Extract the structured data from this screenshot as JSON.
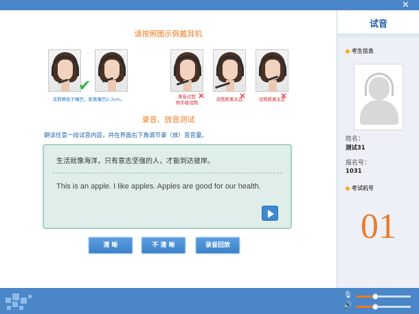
{
  "window": {
    "close_glyph": "✕"
  },
  "main": {
    "wear_title": "请按照图示佩戴耳机",
    "test_title": "录音、放音测试",
    "instruction": "朗读任意一段试音内容，并在界面右下角调节录（放）音音量。",
    "captions": {
      "good_line1": "话筒略低于嘴巴，距离嘴巴2-3cm。",
      "bad1_line1": "录音过程",
      "bad1_line2": "用手碰话筒",
      "bad2": "话筒距离太远",
      "bad3": "话筒距离太近"
    },
    "sample_text": {
      "chinese": "生活就像海洋，只有意志坚强的人，才能到达彼岸。",
      "english": "This is an apple. I like apples. Apples are good for our health."
    },
    "buttons": {
      "clear": "清  晰",
      "unclear": "不 清 晰",
      "playback": "录音回放"
    }
  },
  "sidebar": {
    "title": "试音",
    "candidate_info_label": "考生信息",
    "name_label": "姓名：",
    "name_value": "测试31",
    "exam_id_label": "报名号：",
    "exam_id_value": "1031",
    "machine_label": "考试机号",
    "machine_number": "01"
  },
  "volume": {
    "mic_level": 0.35,
    "speaker_level": 0.35
  },
  "colors": {
    "accent_orange": "#f07a1c",
    "brand_blue": "#4a86c8",
    "caption_blue": "#1f78c8",
    "caption_red": "#d2282e"
  }
}
